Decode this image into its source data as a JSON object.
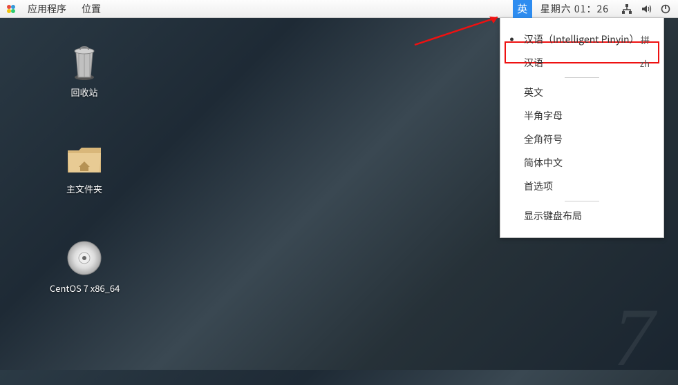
{
  "topbar": {
    "applications": "应用程序",
    "places": "位置",
    "ime_indicator": "英",
    "datetime": "星期六 01：26"
  },
  "desktop": {
    "trash_label": "回收站",
    "home_label": "主文件夹",
    "disc_label": "CentOS 7 x86_64"
  },
  "dropdown": {
    "item1_label": "汉语（Intelligent Pinyin）",
    "item1_abbr": "拼",
    "item2_label": "汉语",
    "item2_abbr": "zh",
    "item3_label": "英文",
    "item4_label": "半角字母",
    "item5_label": "全角符号",
    "item6_label": "简体中文",
    "item7_label": "首选项",
    "item8_label": "显示键盘布局"
  }
}
